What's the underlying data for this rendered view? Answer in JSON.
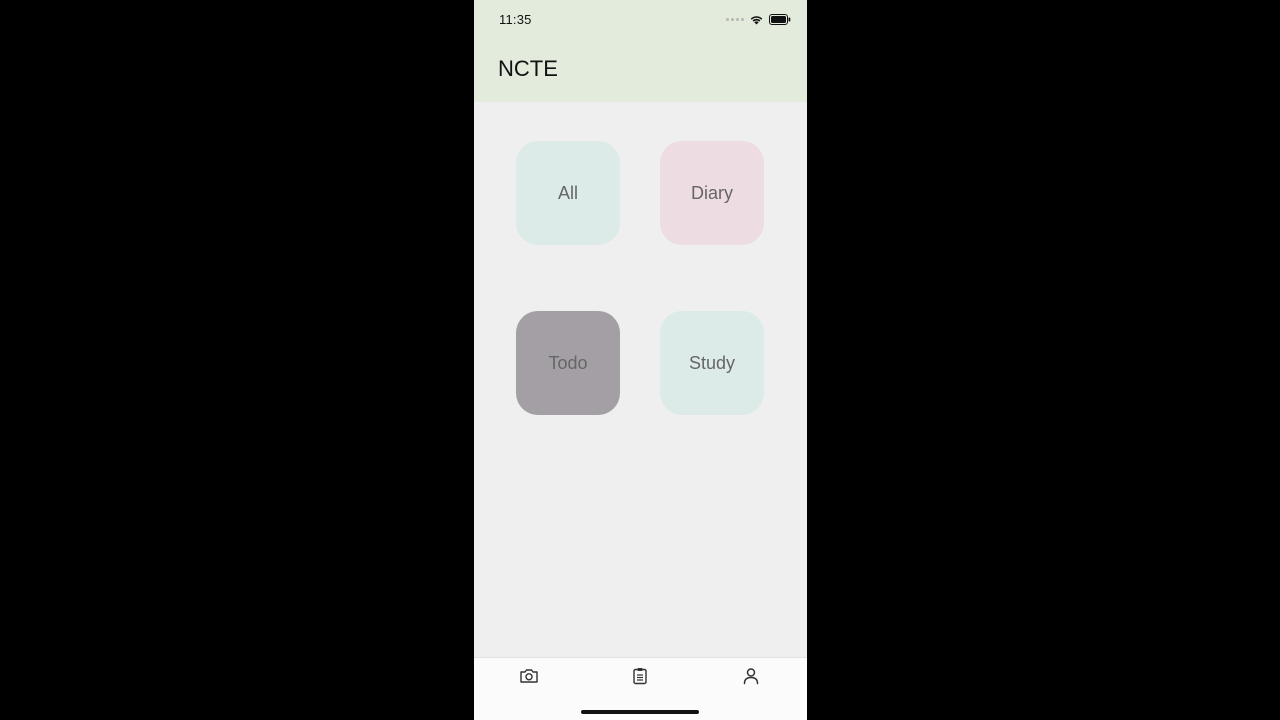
{
  "status_bar": {
    "time": "11:35"
  },
  "header": {
    "title": "NCTE",
    "background": "#e3ebdc"
  },
  "categories": [
    {
      "label": "All",
      "color": "#dcebe8"
    },
    {
      "label": "Diary",
      "color": "#eddde2"
    },
    {
      "label": "Todo",
      "color": "#a39fa5"
    },
    {
      "label": "Study",
      "color": "#dcebe8"
    }
  ],
  "tabbar": {
    "tabs": [
      {
        "icon": "camera-icon"
      },
      {
        "icon": "clipboard-icon"
      },
      {
        "icon": "person-icon"
      }
    ]
  }
}
